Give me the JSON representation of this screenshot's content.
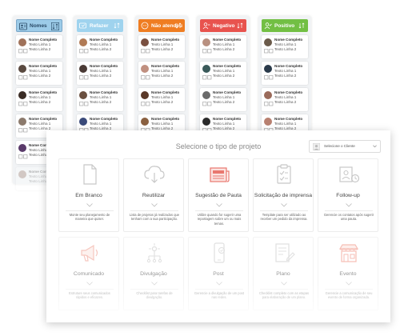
{
  "kanban": {
    "columns": [
      {
        "title": "Nomes",
        "color": "#9ccbe8"
      },
      {
        "title": "Refazer",
        "color": "#9fd3ee"
      },
      {
        "title": "Não atendeu",
        "color": "#ef7d22"
      },
      {
        "title": "Negativo",
        "color": "#e8534e"
      },
      {
        "title": "Positivo",
        "color": "#72bf44"
      }
    ],
    "card": {
      "name": "Nome Completo",
      "line1": "Texto Linha 1",
      "line2": "Texto Linha 2"
    },
    "icons": {
      "header": "person-icon",
      "sort": "sort-icon",
      "card_actions": "card-actions-icon"
    }
  },
  "panel": {
    "title": "Selecione o tipo de projeto",
    "client_select": {
      "placeholder": "Selecione o Cliente",
      "icon": "user-icon"
    },
    "tiles": [
      {
        "label": "Em Branco",
        "desc": "Monte seu planejamento de maneira que quiser.",
        "icon": "blank-document-icon"
      },
      {
        "label": "Reutilizar",
        "desc": "Lista de projetos já realizados que tenham com a sua participação.",
        "icon": "cloud-download-icon"
      },
      {
        "label": "Sugestão de Pauta",
        "desc": "Utilize quando for sugerir uma reportagem sobre um ou mais temas.",
        "icon": "newspaper-icon"
      },
      {
        "label": "Solicitação de imprensa",
        "desc": "Template para ser utilizado ao receber um pedido da imprensa.",
        "icon": "clipboard-check-icon"
      },
      {
        "label": "Follow-up",
        "desc": "Gerencie os contatos após sugerir uma pauta.",
        "icon": "follow-up-icon"
      },
      {
        "label": "Comunicado",
        "desc": "Estruture seus comunicados rápidos e eficazes.",
        "icon": "megaphone-icon"
      },
      {
        "label": "Divulgação",
        "desc": "Checklist para tarefas de divulgação.",
        "icon": "lightbulb-icon"
      },
      {
        "label": "Post",
        "desc": "Gerencie a divulgação de um post nas redes.",
        "icon": "phone-check-icon"
      },
      {
        "label": "Plano",
        "desc": "Checklist completo com as etapas para elaboração de um plano.",
        "icon": "plan-icon"
      },
      {
        "label": "Evento",
        "desc": "Gerencie a comunicação de seu evento de forma organizada.",
        "icon": "store-icon"
      }
    ]
  }
}
